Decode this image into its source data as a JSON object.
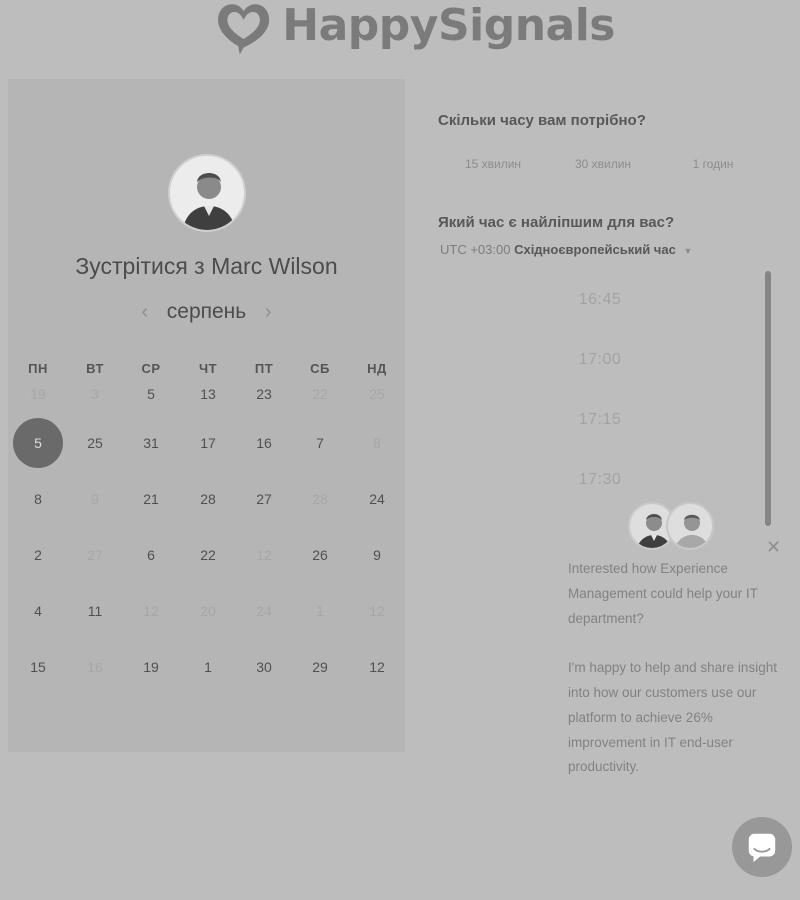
{
  "brand": {
    "name": "HappySignals",
    "color": "#7b7b7b"
  },
  "calendar": {
    "title": "Зустрітися з Marc Wilson",
    "month": "серпень",
    "prev_icon": "chevron-left-icon",
    "next_icon": "chevron-right-icon",
    "weekdays": [
      "ПН",
      "ВТ",
      "СР",
      "ЧТ",
      "ПТ",
      "СБ",
      "НД"
    ],
    "weeks": [
      [
        {
          "d": "19",
          "dim": true
        },
        {
          "d": "3",
          "dim": true
        },
        {
          "d": "5",
          "dim": false
        },
        {
          "d": "13",
          "dim": false
        },
        {
          "d": "23",
          "dim": false
        },
        {
          "d": "22",
          "dim": true
        },
        {
          "d": "25",
          "dim": true
        }
      ],
      [
        {
          "d": "5",
          "dim": false,
          "selected": true
        },
        {
          "d": "25",
          "dim": false
        },
        {
          "d": "31",
          "dim": false
        },
        {
          "d": "17",
          "dim": false
        },
        {
          "d": "16",
          "dim": false
        },
        {
          "d": "7",
          "dim": false
        },
        {
          "d": "8",
          "dim": true
        }
      ],
      [
        {
          "d": "8",
          "dim": false
        },
        {
          "d": "9",
          "dim": true
        },
        {
          "d": "21",
          "dim": false
        },
        {
          "d": "28",
          "dim": false
        },
        {
          "d": "27",
          "dim": false
        },
        {
          "d": "28",
          "dim": true
        },
        {
          "d": "24",
          "dim": false
        }
      ],
      [
        {
          "d": "2",
          "dim": false
        },
        {
          "d": "27",
          "dim": true
        },
        {
          "d": "6",
          "dim": false
        },
        {
          "d": "22",
          "dim": false
        },
        {
          "d": "12",
          "dim": true
        },
        {
          "d": "26",
          "dim": false
        },
        {
          "d": "9",
          "dim": false
        }
      ],
      [
        {
          "d": "4",
          "dim": false
        },
        {
          "d": "11",
          "dim": false
        },
        {
          "d": "12",
          "dim": true
        },
        {
          "d": "20",
          "dim": true
        },
        {
          "d": "24",
          "dim": true
        },
        {
          "d": "1",
          "dim": true
        },
        {
          "d": "12",
          "dim": true
        }
      ],
      [
        {
          "d": "15",
          "dim": false
        },
        {
          "d": "16",
          "dim": true
        },
        {
          "d": "19",
          "dim": false
        },
        {
          "d": "1",
          "dim": false
        },
        {
          "d": "30",
          "dim": false
        },
        {
          "d": "29",
          "dim": false
        },
        {
          "d": "12",
          "dim": false
        }
      ]
    ],
    "selected_color": "#6a6a6a"
  },
  "duration": {
    "question": "Скільки часу вам потрібно?",
    "options": [
      "15 хвилин",
      "30 хвилин",
      "1 годин"
    ]
  },
  "time": {
    "question": "Який час є найліпшим для вас?",
    "timezone_offset": "UTC +03:00",
    "timezone_name": "Східноєвропейський час",
    "slots": [
      "16:45",
      "17:00",
      "17:15",
      "17:30"
    ]
  },
  "chat": {
    "message_1": "Interested how Experience Management could help your IT department?",
    "message_2": "I'm happy to help and share insight into how our customers use our platform to achieve 26% improvement in IT end-user productivity.",
    "close_icon": "close-icon",
    "launcher_icon": "chat-bubble-icon"
  }
}
